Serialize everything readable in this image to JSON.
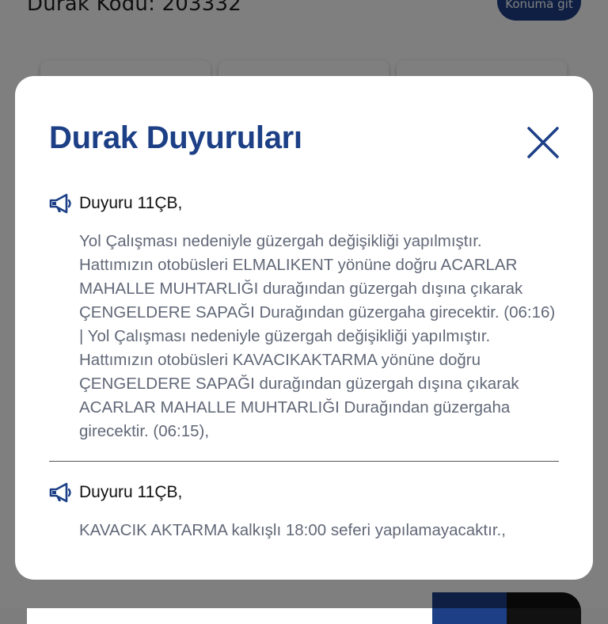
{
  "background": {
    "stop_code": "Durak Kodu: 203332",
    "location_button": "Konuma git"
  },
  "modal": {
    "title": "Durak Duyuruları",
    "close_icon": "close-icon",
    "announcements": [
      {
        "icon": "megaphone-icon",
        "label": "Duyuru  11ÇB,",
        "text": "Yol Çalışması nedeniyle güzergah değişikliği yapılmıştır. Hattımızın otobüsleri ELMALIKENT yönüne doğru ACARLAR MAHALLE MUHTARLIĞI durağından güzergah dışına çıkarak ÇENGELDERE SAPAĞI Durağından güzergaha girecektir.  (06:16) | Yol Çalışması nedeniyle güzergah değişikliği yapılmıştır. Hattımızın otobüsleri KAVACIKAKTARMA yönüne doğru ÇENGELDERE SAPAĞI durağından güzergah dışına çıkarak ACARLAR MAHALLE MUHTARLIĞI Durağından güzergaha girecektir.  (06:15),"
      },
      {
        "icon": "megaphone-icon",
        "label": "Duyuru  11ÇB,",
        "text": "KAVACIK AKTARMA kalkışlı 18:00 seferi yapılamayacaktır.,"
      }
    ]
  },
  "colors": {
    "primary": "#1c3f86",
    "body_text": "#616877",
    "overlay": "rgba(0,0,0,0.5)"
  }
}
